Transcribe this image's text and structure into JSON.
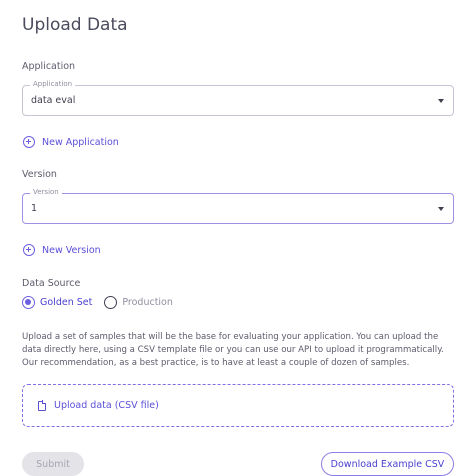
{
  "page": {
    "title": "Upload Data"
  },
  "application": {
    "section_label": "Application",
    "field_label": "Application",
    "value": "data eval",
    "add_label": "New Application"
  },
  "version": {
    "section_label": "Version",
    "field_label": "Version",
    "value": "1",
    "add_label": "New Version"
  },
  "data_source": {
    "label": "Data Source",
    "options": [
      {
        "label": "Golden Set",
        "selected": true
      },
      {
        "label": "Production",
        "selected": false
      }
    ],
    "description": "Upload a set of samples that will be the base for evaluating your application. You can upload the data directly here, using a CSV template file or you can use our API to upload it programmatically. Our recommendation, as a best practice, is to have at least a couple of dozen of samples."
  },
  "upload": {
    "label": "Upload data (CSV file)"
  },
  "actions": {
    "submit_label": "Submit",
    "download_label": "Download Example CSV"
  },
  "colors": {
    "accent": "#6c5fe1",
    "accent_text": "#5b4fd8",
    "border": "#c5c5d3"
  },
  "icons": {
    "add": "plus-circle-icon",
    "dropdown": "chevron-down-icon",
    "file": "file-icon"
  }
}
